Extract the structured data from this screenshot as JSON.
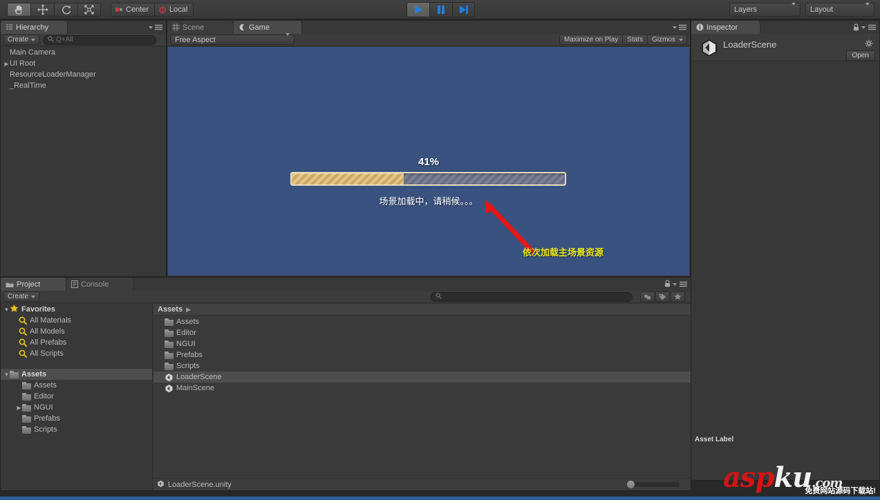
{
  "toolbar": {
    "tools": [
      {
        "name": "hand-tool",
        "icon": "hand-icon",
        "active": true
      },
      {
        "name": "move-tool",
        "icon": "move-icon",
        "active": false
      },
      {
        "name": "rotate-tool",
        "icon": "rotate-icon",
        "active": false
      },
      {
        "name": "scale-tool",
        "icon": "scale-icon",
        "active": false
      }
    ],
    "pivot_mode": "Center",
    "pivot_rotation": "Local",
    "play": "play-icon",
    "pause": "pause-icon",
    "step": "step-icon",
    "layers_label": "Layers",
    "layout_label": "Layout"
  },
  "hierarchy": {
    "tab_label": "Hierarchy",
    "create_label": "Create",
    "search_placeholder": "Q+All",
    "items": [
      {
        "label": "Main Camera",
        "expandable": false
      },
      {
        "label": "UI Root",
        "expandable": true
      },
      {
        "label": "ResourceLoaderManager",
        "expandable": false
      },
      {
        "label": "_RealTime",
        "expandable": false
      }
    ]
  },
  "scene_game": {
    "tabs": [
      {
        "label": "Scene",
        "icon": "grid-icon",
        "active": false
      },
      {
        "label": "Game",
        "icon": "gamepad-icon",
        "active": true
      }
    ],
    "aspect": "Free Aspect",
    "maximize_on_play": "Maximize on Play",
    "stats": "Stats",
    "gizmos": "Gizmos"
  },
  "game_view": {
    "background_color": "#3a5280",
    "progress_percent": 41,
    "progress_label": "41%",
    "loading_text": "场景加载中，请稍候。。。",
    "annotation_text": "依次加载主场景资源",
    "annotation_color": "#e8e819",
    "arrow_color": "#e51616",
    "fill_color": "#dcb877",
    "track_color": "#6a7185"
  },
  "inspector": {
    "tab_label": "Inspector",
    "asset_name": "LoaderScene",
    "open_label": "Open",
    "asset_label_header": "Asset Label"
  },
  "project": {
    "tabs": [
      {
        "label": "Project",
        "icon": "folder-icon",
        "active": true
      },
      {
        "label": "Console",
        "icon": "console-icon",
        "active": false
      }
    ],
    "create_label": "Create",
    "favorites_label": "Favorites",
    "favorites": [
      {
        "label": "All Materials"
      },
      {
        "label": "All Models"
      },
      {
        "label": "All Prefabs"
      },
      {
        "label": "All Scripts"
      }
    ],
    "assets_root_label": "Assets",
    "tree": [
      {
        "label": "Assets",
        "expandable": false
      },
      {
        "label": "Editor",
        "expandable": false
      },
      {
        "label": "NGUI",
        "expandable": true
      },
      {
        "label": "Prefabs",
        "expandable": false
      },
      {
        "label": "Scripts",
        "expandable": false
      }
    ],
    "breadcrumb": "Assets",
    "contents": [
      {
        "label": "Assets",
        "type": "folder",
        "selected": false
      },
      {
        "label": "Editor",
        "type": "folder",
        "selected": false
      },
      {
        "label": "NGUI",
        "type": "folder",
        "selected": false
      },
      {
        "label": "Prefabs",
        "type": "folder",
        "selected": false
      },
      {
        "label": "Scripts",
        "type": "folder",
        "selected": false
      },
      {
        "label": "LoaderScene",
        "type": "scene",
        "selected": true
      },
      {
        "label": "MainScene",
        "type": "scene",
        "selected": false
      }
    ],
    "status_file": "LoaderScene.unity"
  },
  "watermark": {
    "text_a": "asp",
    "text_b": "ku",
    "text_c": ".com",
    "sub": "免费网站源码下载站!",
    "color_red": "#d41414",
    "color_white": "#f2f2f2"
  }
}
